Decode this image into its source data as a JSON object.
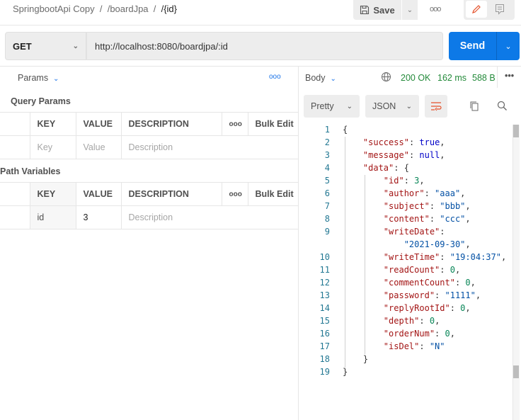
{
  "breadcrumb": [
    "SpringbootApi Copy",
    "/boardJpa",
    "/{id}"
  ],
  "toolbar": {
    "save": "Save",
    "more": "ooo"
  },
  "request": {
    "method": "GET",
    "url": "http://localhost:8080/boardjpa/:id",
    "send": "Send"
  },
  "left": {
    "tab": "Params",
    "more": "ooo",
    "query_title": "Query Params",
    "path_title": "Path Variables",
    "headers": [
      "KEY",
      "VALUE",
      "DESCRIPTION",
      "ooo",
      "Bulk Edit"
    ],
    "query_row": {
      "key": "Key",
      "value": "Value",
      "description": "Description"
    },
    "path_row": {
      "key": "id",
      "value": "3",
      "description": "Description"
    }
  },
  "response": {
    "tab": "Body",
    "status": "200 OK",
    "time": "162 ms",
    "size": "588 B",
    "format": "Pretty",
    "type": "JSON",
    "lines": [
      {
        "n": "1",
        "t": [
          [
            "p",
            "{"
          ]
        ]
      },
      {
        "n": "2",
        "t": [
          [
            "p",
            "    "
          ],
          [
            "k",
            "\"success\""
          ],
          [
            "p",
            ": "
          ],
          [
            "b",
            "true"
          ],
          [
            "p",
            ","
          ]
        ]
      },
      {
        "n": "3",
        "t": [
          [
            "p",
            "    "
          ],
          [
            "k",
            "\"message\""
          ],
          [
            "p",
            ": "
          ],
          [
            "b",
            "null"
          ],
          [
            "p",
            ","
          ]
        ]
      },
      {
        "n": "4",
        "t": [
          [
            "p",
            "    "
          ],
          [
            "k",
            "\"data\""
          ],
          [
            "p",
            ": {"
          ]
        ]
      },
      {
        "n": "5",
        "t": [
          [
            "p",
            "        "
          ],
          [
            "k",
            "\"id\""
          ],
          [
            "p",
            ": "
          ],
          [
            "n",
            "3"
          ],
          [
            "p",
            ","
          ]
        ]
      },
      {
        "n": "6",
        "t": [
          [
            "p",
            "        "
          ],
          [
            "k",
            "\"author\""
          ],
          [
            "p",
            ": "
          ],
          [
            "s",
            "\"aaa\""
          ],
          [
            "p",
            ","
          ]
        ]
      },
      {
        "n": "7",
        "t": [
          [
            "p",
            "        "
          ],
          [
            "k",
            "\"subject\""
          ],
          [
            "p",
            ": "
          ],
          [
            "s",
            "\"bbb\""
          ],
          [
            "p",
            ","
          ]
        ]
      },
      {
        "n": "8",
        "t": [
          [
            "p",
            "        "
          ],
          [
            "k",
            "\"content\""
          ],
          [
            "p",
            ": "
          ],
          [
            "s",
            "\"ccc\""
          ],
          [
            "p",
            ","
          ]
        ]
      },
      {
        "n": "9",
        "t": [
          [
            "p",
            "        "
          ],
          [
            "k",
            "\"writeDate\""
          ],
          [
            "p",
            ":"
          ]
        ]
      },
      {
        "n": "",
        "t": [
          [
            "p",
            "            "
          ],
          [
            "s",
            "\"2021-09-30\""
          ],
          [
            "p",
            ","
          ]
        ]
      },
      {
        "n": "10",
        "t": [
          [
            "p",
            "        "
          ],
          [
            "k",
            "\"writeTime\""
          ],
          [
            "p",
            ": "
          ],
          [
            "s",
            "\"19:04:37\""
          ],
          [
            "p",
            ","
          ]
        ]
      },
      {
        "n": "11",
        "t": [
          [
            "p",
            "        "
          ],
          [
            "k",
            "\"readCount\""
          ],
          [
            "p",
            ": "
          ],
          [
            "n",
            "0"
          ],
          [
            "p",
            ","
          ]
        ]
      },
      {
        "n": "12",
        "t": [
          [
            "p",
            "        "
          ],
          [
            "k",
            "\"commentCount\""
          ],
          [
            "p",
            ": "
          ],
          [
            "n",
            "0"
          ],
          [
            "p",
            ","
          ]
        ]
      },
      {
        "n": "13",
        "t": [
          [
            "p",
            "        "
          ],
          [
            "k",
            "\"password\""
          ],
          [
            "p",
            ": "
          ],
          [
            "s",
            "\"1111\""
          ],
          [
            "p",
            ","
          ]
        ]
      },
      {
        "n": "14",
        "t": [
          [
            "p",
            "        "
          ],
          [
            "k",
            "\"replyRootId\""
          ],
          [
            "p",
            ": "
          ],
          [
            "n",
            "0"
          ],
          [
            "p",
            ","
          ]
        ]
      },
      {
        "n": "15",
        "t": [
          [
            "p",
            "        "
          ],
          [
            "k",
            "\"depth\""
          ],
          [
            "p",
            ": "
          ],
          [
            "n",
            "0"
          ],
          [
            "p",
            ","
          ]
        ]
      },
      {
        "n": "16",
        "t": [
          [
            "p",
            "        "
          ],
          [
            "k",
            "\"orderNum\""
          ],
          [
            "p",
            ": "
          ],
          [
            "n",
            "0"
          ],
          [
            "p",
            ","
          ]
        ]
      },
      {
        "n": "17",
        "t": [
          [
            "p",
            "        "
          ],
          [
            "k",
            "\"isDel\""
          ],
          [
            "p",
            ": "
          ],
          [
            "s",
            "\"N\""
          ]
        ]
      },
      {
        "n": "18",
        "t": [
          [
            "p",
            "    }"
          ]
        ]
      },
      {
        "n": "19",
        "t": [
          [
            "p",
            "}"
          ]
        ]
      }
    ]
  }
}
